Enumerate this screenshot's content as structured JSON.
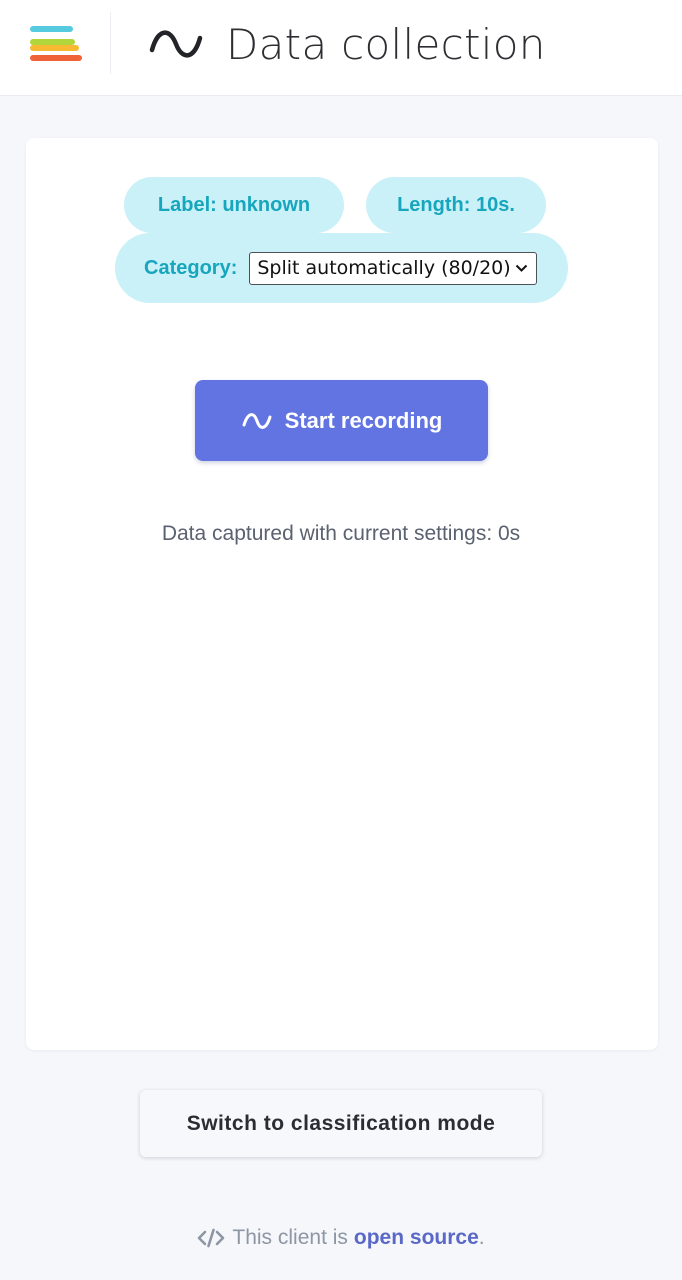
{
  "header": {
    "menu_icon": "menu-icon",
    "wave_icon": "wave-icon",
    "title": "Data collection"
  },
  "settings": {
    "label_pill": "Label: unknown",
    "length_pill": "Length: 10s.",
    "category_label": "Category:",
    "category_selected": "Split automatically (80/20)"
  },
  "record_button": {
    "icon": "wave-icon",
    "label": "Start recording"
  },
  "status": {
    "captured_text": "Data captured with current settings: 0s"
  },
  "switch_button": {
    "label": "Switch to classification mode"
  },
  "footer": {
    "icon": "code-icon",
    "prefix": "This client is",
    "link": "open source",
    "suffix": "."
  },
  "colors": {
    "pill_background": "#caf1f8",
    "pill_text": "#17a6bd",
    "primary_button": "#6174e1",
    "link": "#5a68c6"
  }
}
